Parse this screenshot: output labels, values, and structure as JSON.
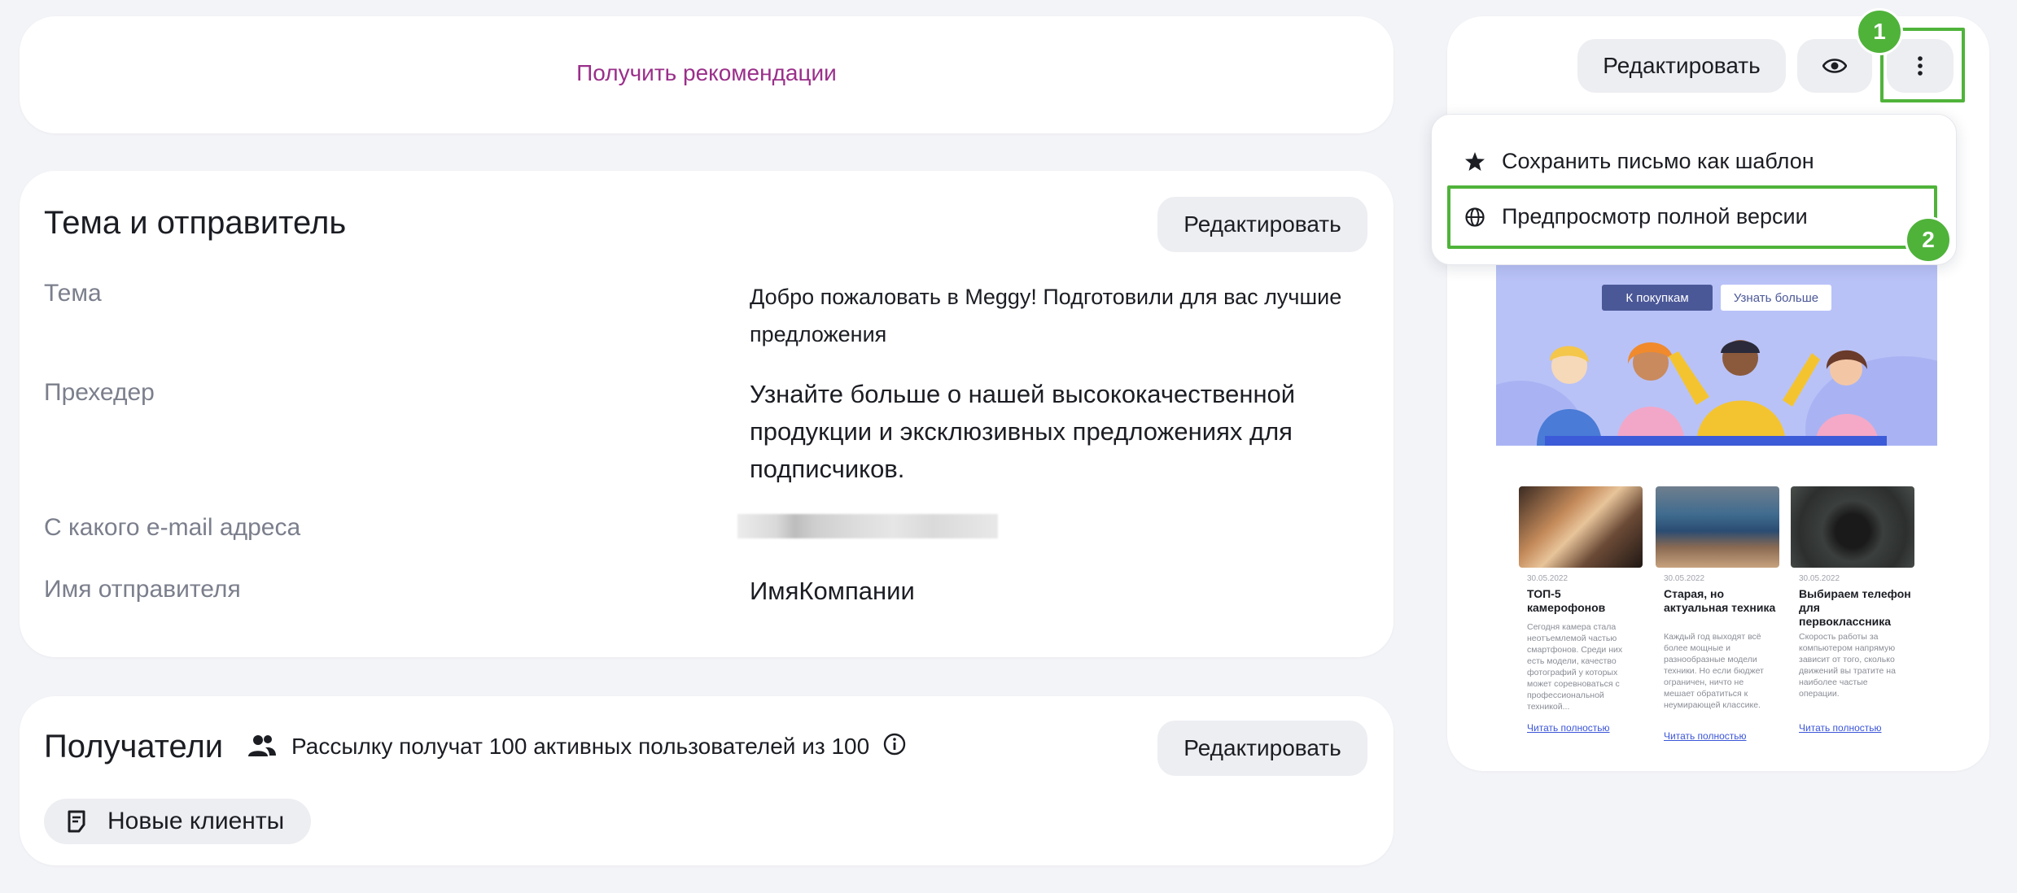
{
  "recommendations": {
    "link_label": "Получить рекомендации"
  },
  "subject_sender": {
    "title": "Тема и отправитель",
    "edit_label": "Редактировать",
    "fields": [
      {
        "label": "Тема",
        "value": "Добро пожаловать в Meggy! Подготовили для вас лучшие предложения"
      },
      {
        "label": "Прехедер",
        "value": "Узнайте больше о нашей высококачественной продукции и эксклюзивных предложениях для подписчиков."
      },
      {
        "label": "С какого e-mail адреса",
        "value": ""
      },
      {
        "label": "Имя отправителя",
        "value": "ИмяКомпании"
      }
    ]
  },
  "recipients": {
    "title": "Получатели",
    "summary": "Рассылку получат 100 активных пользователей из 100",
    "edit_label": "Редактировать",
    "segment_tag": "Новые клиенты"
  },
  "preview": {
    "edit_label": "Редактировать",
    "menu_items": [
      {
        "label": "Сохранить письмо как шаблон",
        "icon": "star-icon"
      },
      {
        "label": "Предпросмотр полной версии",
        "icon": "globe-icon"
      }
    ],
    "markers": [
      "1",
      "2"
    ],
    "hero": {
      "primary_button": "К покупкам",
      "secondary_button": "Узнать больше"
    },
    "products": [
      {
        "date": "30.05.2022",
        "title": "ТОП-5 камерофонов",
        "desc": "Сегодня камера стала неотъемлемой частью смартфонов. Среди них есть модели, качество фотографий у которых может соревноваться с профессиональной техникой...",
        "link": "Читать полностью"
      },
      {
        "date": "30.05.2022",
        "title": "Старая, но актуальная техника",
        "desc": "Каждый год выходят всё более мощные и разнообразные модели техники. Но если бюджет ограничен, ничто не мешает обратиться к неумирающей классике.",
        "link": "Читать полностью"
      },
      {
        "date": "30.05.2022",
        "title": "Выбираем телефон для первоклассника",
        "desc": "Скорость работы за компьютером напрямую зависит от того, сколько движений вы тратите на наиболее частые операции.",
        "link": "Читать полностью"
      }
    ]
  },
  "colors": {
    "accent_purple": "#9a2f8a",
    "highlight_green": "#4fb33a",
    "button_bg": "#edeef2",
    "hero_button": "#4b5898"
  }
}
